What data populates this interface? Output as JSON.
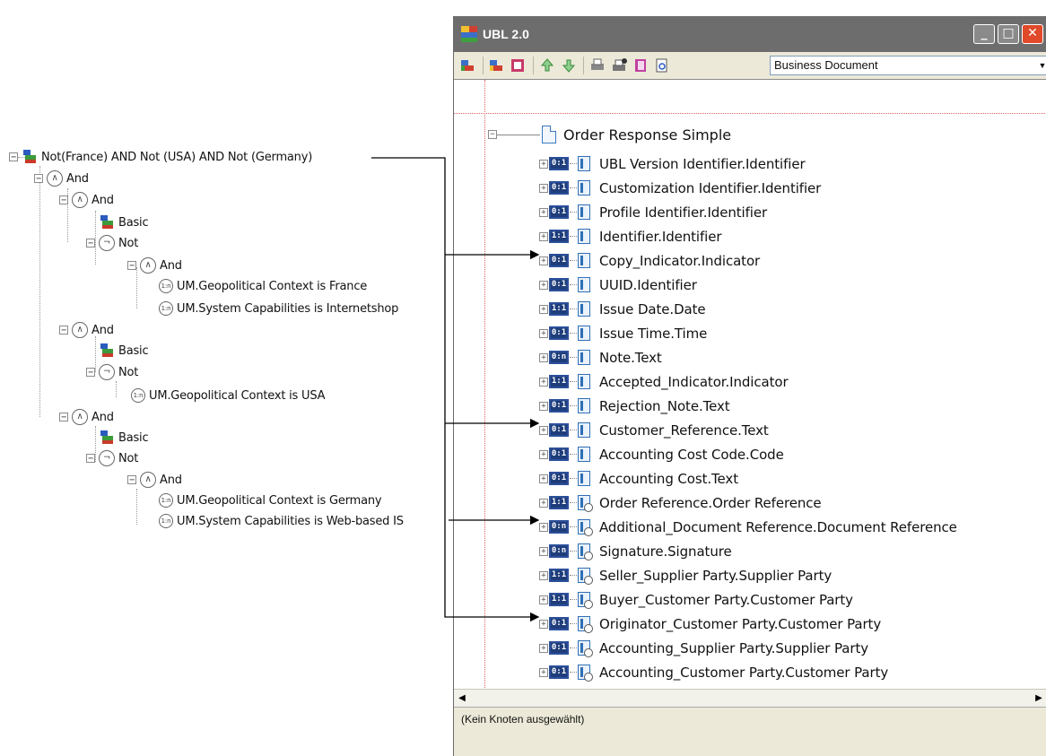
{
  "context_tree": {
    "root": "Not(France) AND Not (USA) AND Not (Germany)",
    "n_and1": "And",
    "n_and2": "And",
    "n_basic1": "Basic",
    "n_not1": "Not",
    "n_and3": "And",
    "n_france": "UM.Geopolitical Context is France",
    "n_internetshop": "UM.System Capabilities is Internetshop",
    "n_and4": "And",
    "n_basic2": "Basic",
    "n_not2": "Not",
    "n_usa": "UM.Geopolitical Context is USA",
    "n_and5": "And",
    "n_basic3": "Basic",
    "n_not3": "Not",
    "n_and6": "And",
    "n_germany": "UM.Geopolitical Context is Germany",
    "n_webbased": "UM.System Capabilities is Web-based IS"
  },
  "window": {
    "title": "UBL 2.0",
    "document_select": "Business Document",
    "root_node": "Order Response Simple",
    "rows": [
      {
        "card": "0:1",
        "label": "UBL Version Identifier.Identifier"
      },
      {
        "card": "0:1",
        "label": "Customization Identifier.Identifier"
      },
      {
        "card": "0:1",
        "label": "Profile Identifier.Identifier"
      },
      {
        "card": "1:1",
        "label": "Identifier.Identifier"
      },
      {
        "card": "0:1",
        "label": "Copy_Indicator.Indicator"
      },
      {
        "card": "0:1",
        "label": "UUID.Identifier"
      },
      {
        "card": "1:1",
        "label": "Issue Date.Date"
      },
      {
        "card": "0:1",
        "label": "Issue Time.Time"
      },
      {
        "card": "0:n",
        "label": "Note.Text"
      },
      {
        "card": "1:1",
        "label": "Accepted_Indicator.Indicator"
      },
      {
        "card": "0:1",
        "label": "Rejection_Note.Text"
      },
      {
        "card": "0:1",
        "label": "Customer_Reference.Text"
      },
      {
        "card": "0:1",
        "label": "Accounting Cost Code.Code"
      },
      {
        "card": "0:1",
        "label": "Accounting Cost.Text"
      },
      {
        "card": "1:1",
        "label": "Order Reference.Order Reference"
      },
      {
        "card": "0:n",
        "label": "Additional_Document Reference.Document Reference"
      },
      {
        "card": "0:n",
        "label": "Signature.Signature"
      },
      {
        "card": "1:1",
        "label": "Seller_Supplier Party.Supplier Party"
      },
      {
        "card": "1:1",
        "label": "Buyer_Customer Party.Customer Party"
      },
      {
        "card": "0:1",
        "label": "Originator_Customer Party.Customer Party"
      },
      {
        "card": "0:1",
        "label": "Accounting_Supplier Party.Supplier Party"
      },
      {
        "card": "0:1",
        "label": "Accounting_Customer Party.Customer Party"
      }
    ],
    "status": "(Kein Knoten ausgewählt)"
  }
}
